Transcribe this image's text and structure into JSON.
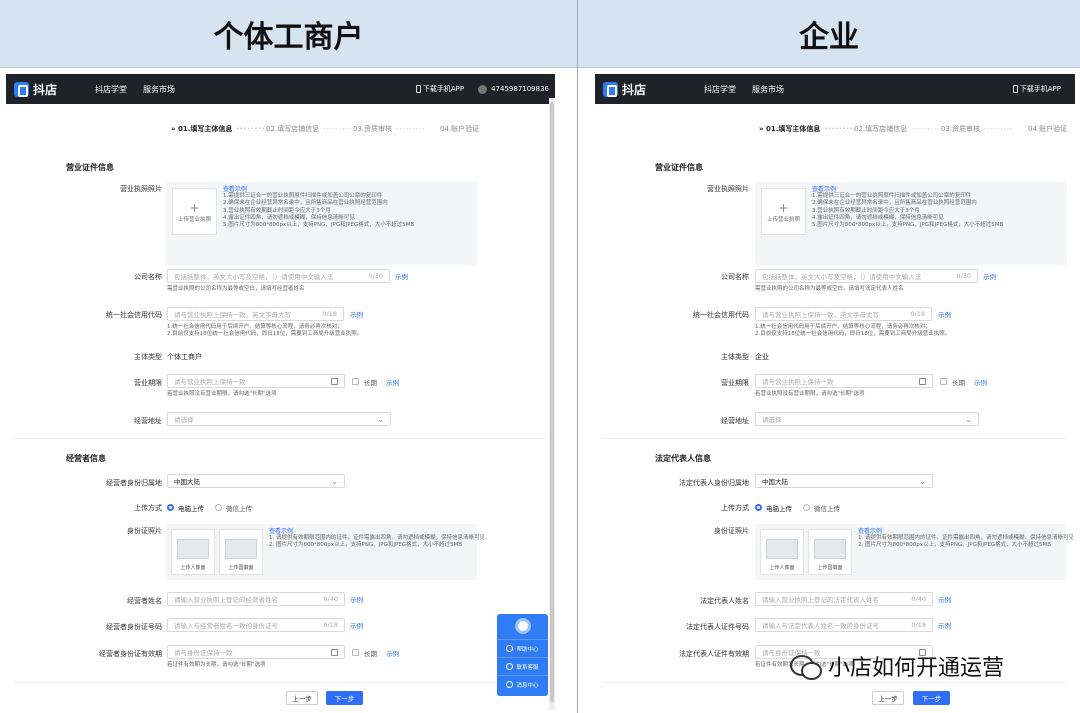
{
  "headers": {
    "left": "个体工商户",
    "right": "企业"
  },
  "app": {
    "logo": "抖店",
    "nav": [
      "抖店学堂",
      "服务市场"
    ],
    "download": "下载手机APP",
    "account": "4745987109836"
  },
  "steps": [
    "» 01.填写主体信息",
    "02.填写店铺信息",
    "03.资质审核",
    "04.账户验证"
  ],
  "step_dots": "·········",
  "license": {
    "section": "营业证件信息",
    "photo_label": "营业执照照片",
    "upload_text": "上传营业执照",
    "upload_plus": "+",
    "example_title": "查看示例",
    "notes": [
      "1.需提供三证合一的营业执照原件扫描件或加盖公司公章的复印件",
      "2.确保未在企业经营异常名录中，且所售商品在营业执照经营范围内",
      "3.营业执照有效期截止时间距今应大于3个月",
      "4.露出证件四角，请勿遮挡或模糊，保持信息清晰可见",
      "5.图片尺寸为800*800px以上，支持PNG、JPG和JPEG格式，大小不超过5MB"
    ],
    "company_label": "公司名称",
    "company_placeholder": "包括括整体，英文大小写及空格，（）请使用中文输入法",
    "company_count": "0/30",
    "example": "示例",
    "company_hint_left": "需营业执照的公司名称为最等或空白，请填写经营者姓名",
    "company_hint_right": "需营业执照的公司名称为最等或空白，请填写法定代表人姓名",
    "credit_label": "统一社会信用代码",
    "credit_placeholder": "请与营业执照上保持一致，英文字母大写",
    "credit_count": "0/18",
    "credit_hint1": "1.统一社会信用代码用于后续开户、结算等核心流程，请务必再次核对；",
    "credit_hint2": "2.目前仅支持18位统一社会信用代码，即日18位，需要到工商局升级营业执照。",
    "type_label": "主体类型",
    "type_left": "个体工商户",
    "type_right": "企业",
    "term_label": "营业期限",
    "term_placeholder": "请与营业执照上保持一致",
    "long_term": "长期",
    "term_hint": "若营业执照没有营业期限，请勾选\"长期\"选项",
    "address_label": "经营地址",
    "address_placeholder": "请选择"
  },
  "operator_left": {
    "section": "经营者信息",
    "region_label": "经营者身份归属地",
    "name_label": "经营者姓名",
    "name_placeholder": "请输入营业执照上登记的经营者姓名",
    "idno_label": "经营者身份证号码",
    "idno_placeholder": "请输入与经营者姓名一致的身份证号",
    "validity_label": "经营者身份证有效期"
  },
  "operator_right": {
    "section": "法定代表人信息",
    "region_label": "法定代表人身份归属地",
    "name_label": "法定代表人姓名",
    "name_placeholder": "请输入营业执照上登记的法定代表人姓名",
    "idno_label": "法定代表人证件号码",
    "idno_placeholder": "请输入与法定代表人姓名一致的身份证号",
    "validity_label": "法定代表人证件有效期"
  },
  "operator_common": {
    "region_value": "中国大陆",
    "upload_method_label": "上传方式",
    "pc_upload": "电脑上传",
    "wechat_upload": "微信上传",
    "id_photo_label": "身份证照片",
    "id_front": "上传人像面",
    "id_back": "上传国徽面",
    "id_example_title": "查看示例",
    "id_notes": [
      "1. 请提供有效期限范围内的证件，证件需露出四角，请勿遮挡或模糊，保持信息清晰可见",
      "2. 图片尺寸为800*800px以上，支持PNG、JPG和JPEG格式，大小不超过5MB"
    ],
    "name_count": "0/40",
    "idno_count": "0/18",
    "validity_placeholder": "请与身份证保持一致",
    "validity_hint": "若证件有效期为长期，请勾选\"长期\"选项"
  },
  "buttons": {
    "prev": "上一步",
    "next": "下一步"
  },
  "float_menu": [
    "帮助中心",
    "联系客服",
    "消息中心"
  ],
  "watermark": "小店如何开通运营"
}
